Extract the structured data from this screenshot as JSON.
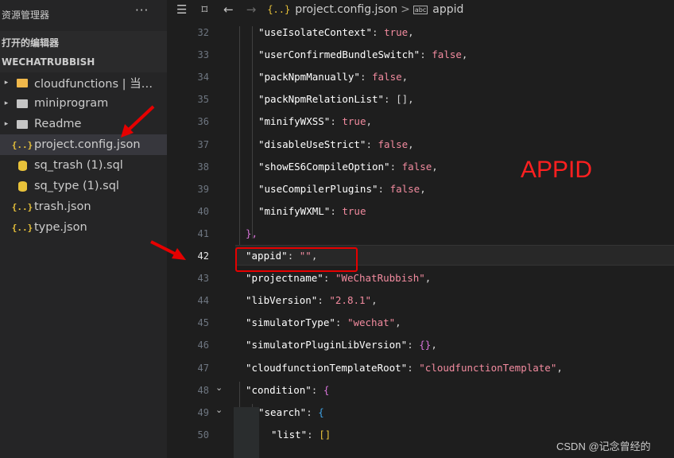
{
  "explorer": {
    "title": "资源管理器",
    "more": "···",
    "open_editors": "打开的编辑器",
    "project": "WECHATRUBBISH",
    "files": [
      {
        "label": "cloudfunctions | 当前...",
        "icon": "cloud-folder-icon",
        "chevron": "▸"
      },
      {
        "label": "miniprogram",
        "icon": "folder-icon",
        "chevron": "▸"
      },
      {
        "label": "Readme",
        "icon": "folder-icon",
        "chevron": "▸"
      },
      {
        "label": "project.config.json",
        "icon": "json-icon",
        "chevron": ""
      },
      {
        "label": "sq_trash (1).sql",
        "icon": "database-icon",
        "chevron": ""
      },
      {
        "label": "sq_type (1).sql",
        "icon": "database-icon",
        "chevron": ""
      },
      {
        "label": "trash.json",
        "icon": "json-icon",
        "chevron": ""
      },
      {
        "label": "type.json",
        "icon": "json-icon",
        "chevron": ""
      }
    ],
    "json_glyph": "{..}"
  },
  "breadcrumb": {
    "file": "project.config.json",
    "separator": ">",
    "symbol": "appid",
    "file_icon": "{..}",
    "symbol_icon": "abc"
  },
  "editor": {
    "current_line": "42",
    "lines": [
      {
        "n": "32",
        "indent": 2,
        "key": "\"useIsolateContext\"",
        "val": "true",
        "vtype": "b",
        "tail": ","
      },
      {
        "n": "33",
        "indent": 2,
        "key": "\"userConfirmedBundleSwitch\"",
        "val": "false",
        "vtype": "b",
        "tail": ","
      },
      {
        "n": "34",
        "indent": 2,
        "key": "\"packNpmManually\"",
        "val": "false",
        "vtype": "b",
        "tail": ","
      },
      {
        "n": "35",
        "indent": 2,
        "key": "\"packNpmRelationList\"",
        "val": "[]",
        "vtype": "p",
        "tail": ","
      },
      {
        "n": "36",
        "indent": 2,
        "key": "\"minifyWXSS\"",
        "val": "true",
        "vtype": "b",
        "tail": ","
      },
      {
        "n": "37",
        "indent": 2,
        "key": "\"disableUseStrict\"",
        "val": "false",
        "vtype": "b",
        "tail": ","
      },
      {
        "n": "38",
        "indent": 2,
        "key": "\"showES6CompileOption\"",
        "val": "false",
        "vtype": "b",
        "tail": ","
      },
      {
        "n": "39",
        "indent": 2,
        "key": "\"useCompilerPlugins\"",
        "val": "false",
        "vtype": "b",
        "tail": ","
      },
      {
        "n": "40",
        "indent": 2,
        "key": "\"minifyWXML\"",
        "val": "true",
        "vtype": "b",
        "tail": ""
      },
      {
        "n": "41",
        "indent": 1,
        "raw": "},",
        "rawtype": "br2"
      },
      {
        "n": "42",
        "indent": 1,
        "key": "\"appid\"",
        "val": "\"\"",
        "vtype": "s",
        "tail": ","
      },
      {
        "n": "43",
        "indent": 1,
        "key": "\"projectname\"",
        "val": "\"WeChatRubbish\"",
        "vtype": "s",
        "tail": ","
      },
      {
        "n": "44",
        "indent": 1,
        "key": "\"libVersion\"",
        "val": "\"2.8.1\"",
        "vtype": "s",
        "tail": ","
      },
      {
        "n": "45",
        "indent": 1,
        "key": "\"simulatorType\"",
        "val": "\"wechat\"",
        "vtype": "s",
        "tail": ","
      },
      {
        "n": "46",
        "indent": 1,
        "key": "\"simulatorPluginLibVersion\"",
        "val": "{}",
        "vtype": "br2",
        "tail": ","
      },
      {
        "n": "47",
        "indent": 1,
        "key": "\"cloudfunctionTemplateRoot\"",
        "val": "\"cloudfunctionTemplate\"",
        "vtype": "s",
        "tail": ","
      },
      {
        "n": "48",
        "indent": 1,
        "key": "\"condition\"",
        "val": "{",
        "vtype": "br2",
        "tail": "",
        "fold": "⌄"
      },
      {
        "n": "49",
        "indent": 2,
        "key": "\"search\"",
        "val": "{",
        "vtype": "br3",
        "tail": "",
        "fold": "⌄"
      },
      {
        "n": "50",
        "indent": 3,
        "key": "\"list\"",
        "val": "[]",
        "vtype": "br1",
        "tail": ""
      }
    ]
  },
  "annotation": {
    "label": "APPID"
  },
  "watermark": "CSDN @记念曾经的"
}
